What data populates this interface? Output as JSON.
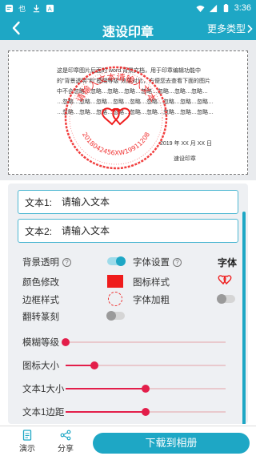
{
  "status_bar": {
    "time": "3:36"
  },
  "header": {
    "title": "速设印章",
    "more_label": "更多类型"
  },
  "preview": {
    "doc_lines": [
      "这是印章图片后面的 word 背景文档，用于印章编辑功能中",
      "的\"背景透明\"和\"模糊等级\"效果对比，方便您去查看下面的图片",
      "中不会忽略…忽略…忽略…忽略…忽略…忽略…忽略…忽略…",
      "…忽略…忽略…忽略…忽略…忽略…忽略…忽略…忽略…忽略…",
      "…忽略…忽略…忽略…忽略…忽略…忽略…忽略…忽略…忽略…"
    ],
    "doc_date": "2019 年 XX 月 XX 日",
    "doc_signature": "速设印章",
    "stamp_text_top": "请输入文本请输入文本",
    "stamp_text_bottom": "2018042456XW19911208"
  },
  "form": {
    "text1": {
      "label": "文本1:",
      "placeholder": "请输入文本"
    },
    "text2": {
      "label": "文本2:",
      "placeholder": "请输入文本"
    },
    "options": {
      "bg_transparent": "背景透明",
      "font_setting": "字体设置",
      "font_name": "字体",
      "color_modify": "颜色修改",
      "icon_style": "图标样式",
      "border_style": "边框样式",
      "font_bold": "字体加粗",
      "flip_seal": "翻转篆刻"
    },
    "toggles": {
      "bg_transparent": true,
      "font_bold": false,
      "flip_seal": false
    },
    "sliders": [
      {
        "label": "模糊等级",
        "value": 0.0
      },
      {
        "label": "图标大小",
        "value": 0.18
      },
      {
        "label": "文本1大小",
        "value": 0.5
      },
      {
        "label": "文本1边距",
        "value": 0.5
      }
    ]
  },
  "colors": {
    "accent": "#1ea7c5",
    "stamp_red": "#ef1c1c",
    "slider_red": "#e31e4a"
  },
  "bottom_bar": {
    "demo_label": "演示",
    "share_label": "分享",
    "download_label": "下载到相册"
  }
}
